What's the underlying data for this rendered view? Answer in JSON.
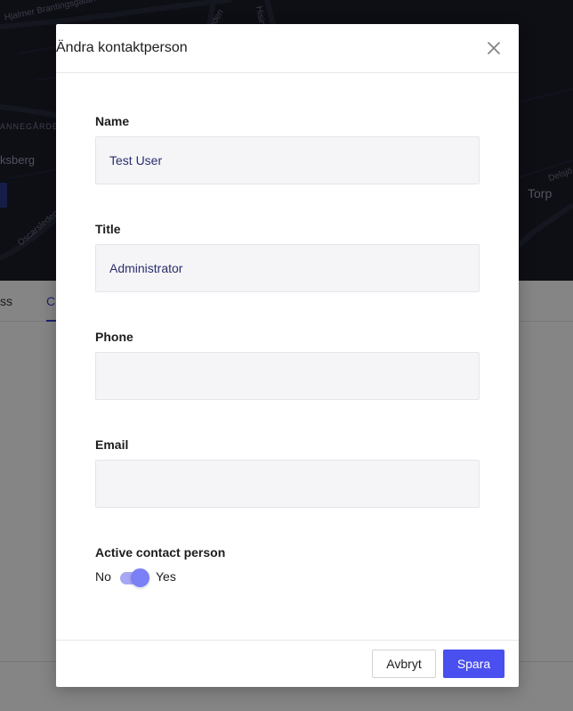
{
  "background": {
    "map_labels": {
      "street_top": "Hjalmer Brantingsgatan",
      "district": "ANNEGÅRDEN",
      "area_left": "ksberg",
      "street_left": "Oscarsleden",
      "street_mid": "Hisingsleden",
      "road_mid": "leden",
      "area_right": "Torp",
      "street_right": "Delsjö"
    },
    "tabs": [
      "ss",
      "C"
    ]
  },
  "modal": {
    "title": "Ändra kontaktperson",
    "fields": {
      "name": {
        "label": "Name",
        "value": "Test User",
        "placeholder": ""
      },
      "title": {
        "label": "Title",
        "value": "Administrator",
        "placeholder": ""
      },
      "phone": {
        "label": "Phone",
        "value": "",
        "placeholder": ""
      },
      "email": {
        "label": "Email",
        "value": "",
        "placeholder": ""
      }
    },
    "active": {
      "label": "Active contact person",
      "off_label": "No",
      "on_label": "Yes",
      "enabled": true
    },
    "buttons": {
      "cancel": "Avbryt",
      "save": "Spara"
    }
  },
  "icons": {
    "close": "close-icon"
  },
  "colors": {
    "accent": "#4a4ff0",
    "toggle_track": "#a6a8f5",
    "toggle_knob": "#7b80f7",
    "input_bg": "#f5f5f7",
    "input_text": "#2a2f6b",
    "overlay": "rgba(0,0,0,0.48)"
  }
}
